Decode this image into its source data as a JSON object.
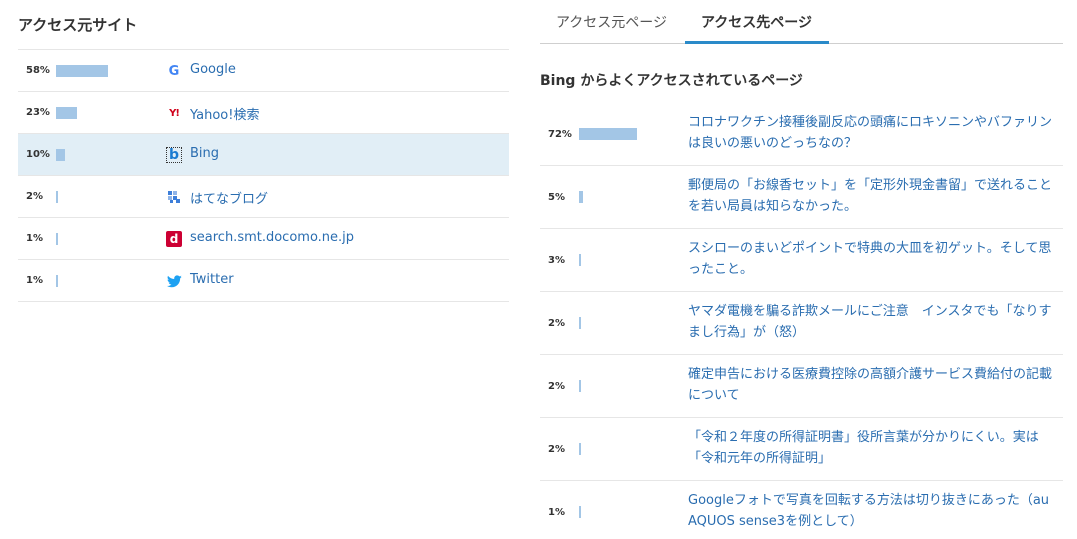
{
  "left": {
    "title": "アクセス元サイト",
    "sources": [
      {
        "pct": "58%",
        "ratio": 0.58,
        "icon": "google-icon",
        "label": "Google"
      },
      {
        "pct": "23%",
        "ratio": 0.23,
        "icon": "yahoo-icon",
        "label": "Yahoo!検索"
      },
      {
        "pct": "10%",
        "ratio": 0.1,
        "icon": "bing-icon",
        "label": "Bing",
        "selected": true
      },
      {
        "pct": "2%",
        "ratio": 0.02,
        "icon": "hatena-blog-icon",
        "label": "はてなブログ"
      },
      {
        "pct": "1%",
        "ratio": 0.01,
        "icon": "docomo-icon",
        "label": "search.smt.docomo.ne.jp"
      },
      {
        "pct": "1%",
        "ratio": 0.01,
        "icon": "twitter-icon",
        "label": "Twitter"
      }
    ]
  },
  "right": {
    "tabs": [
      {
        "label": "アクセス元ページ",
        "active": false
      },
      {
        "label": "アクセス先ページ",
        "active": true
      }
    ],
    "title": "Bing からよくアクセスされているページ",
    "pages": [
      {
        "pct": "72%",
        "ratio": 0.72,
        "label": "コロナワクチン接種後副反応の頭痛にロキソニンやバファリンは良いの悪いのどっちなの？"
      },
      {
        "pct": "5%",
        "ratio": 0.05,
        "label": "郵便局の「お線香セット」を「定形外現金書留」で送れることを若い局員は知らなかった。"
      },
      {
        "pct": "3%",
        "ratio": 0.03,
        "label": "スシローのまいどポイントで特典の大皿を初ゲット。そして思ったこと。"
      },
      {
        "pct": "2%",
        "ratio": 0.02,
        "label": "ヤマダ電機を騙る詐欺メールにご注意　インスタでも「なりすまし行為」が（怒）"
      },
      {
        "pct": "2%",
        "ratio": 0.02,
        "label": "確定申告における医療費控除の高額介護サービス費給付の記載について"
      },
      {
        "pct": "2%",
        "ratio": 0.02,
        "label": "「令和２年度の所得証明書」役所言葉が分かりにくい。実は「令和元年の所得証明」"
      },
      {
        "pct": "1%",
        "ratio": 0.01,
        "label": "Googleフォトで写真を回転する方法は切り抜きにあった（au AQUOS sense3を例として）"
      }
    ]
  },
  "colors": {
    "bar": "#a3c6e6",
    "link": "#2a6db0",
    "selected_row": "#e1eef6",
    "tab_accent": "#2a8ac9"
  }
}
